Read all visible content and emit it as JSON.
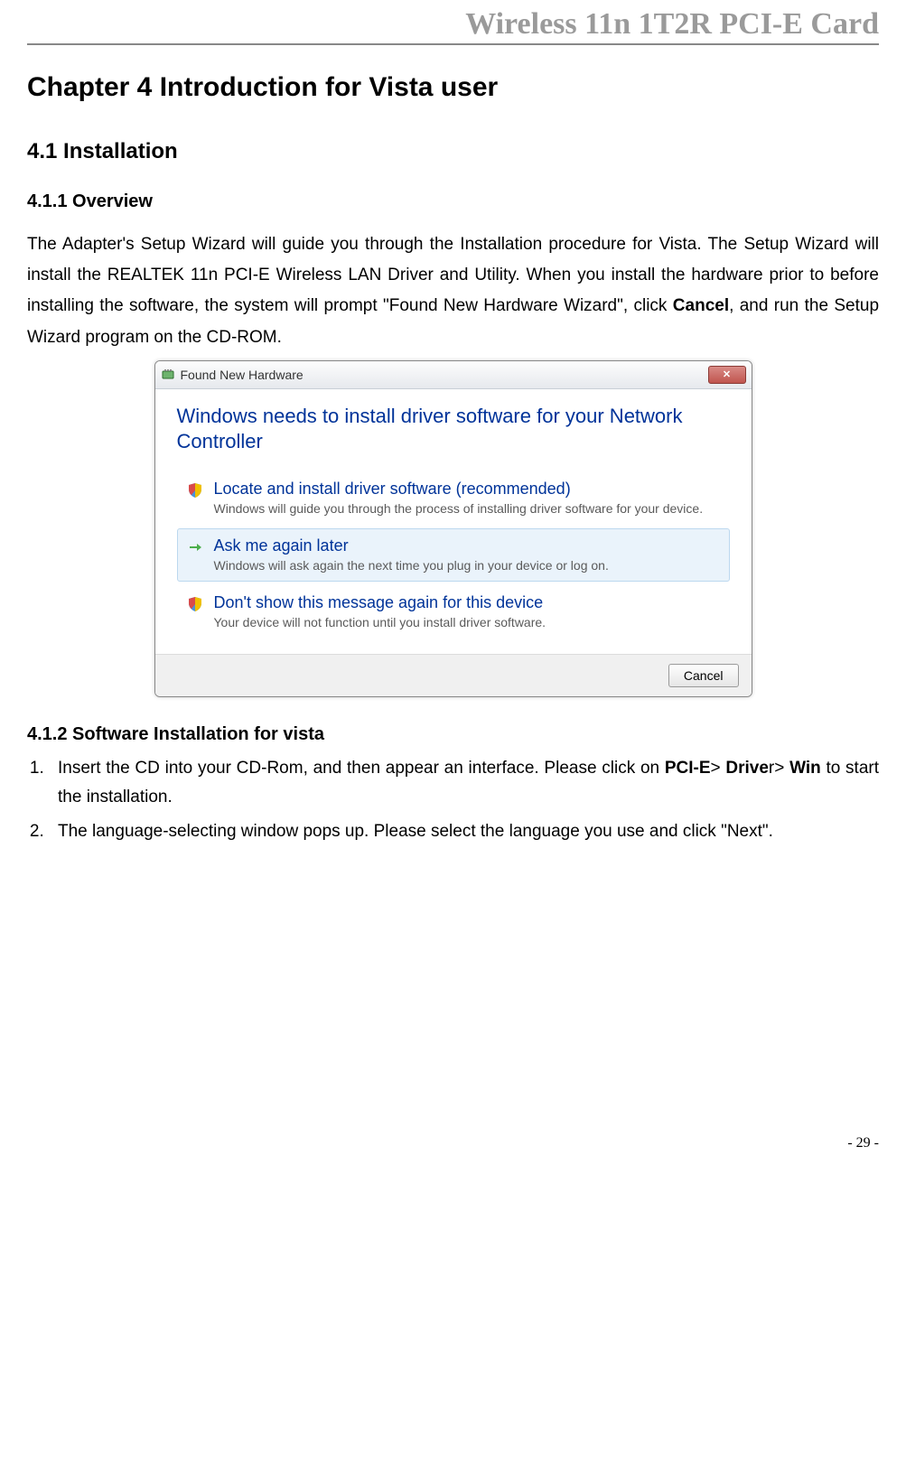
{
  "header": "Wireless 11n 1T2R PCI-E Card",
  "chapter": "Chapter 4    Introduction for Vista user",
  "section_4_1": "4.1 Installation",
  "sub_4_1_1": {
    "title": "4.1.1    Overview",
    "p_part1": "The Adapter's Setup Wizard will guide you through the Installation procedure for Vista. The Setup Wizard will install the REALTEK 11n PCI-E Wireless LAN Driver and Utility. When you install the hardware prior to before installing the software, the system will prompt \"Found New Hardware Wizard\", click ",
    "p_bold": "Cancel",
    "p_part2": ", and run the Setup Wizard program on the CD-ROM."
  },
  "dialog": {
    "title": "Found New Hardware",
    "heading": "Windows needs to install driver software for your Network Controller",
    "opt1": {
      "title": "Locate and install driver software (recommended)",
      "desc": "Windows will guide you through the process of installing driver software for your device."
    },
    "opt2": {
      "title": "Ask me again later",
      "desc": "Windows will ask again the next time you plug in your device or log on."
    },
    "opt3": {
      "title": "Don't show this message again for this device",
      "desc": "Your device will not function until you install driver software."
    },
    "cancel": "Cancel"
  },
  "sub_4_1_2": {
    "title": "4.1.2    Software Installation for vista",
    "li1_a": "Insert the CD into your CD-Rom, and then appear an interface. Please click on ",
    "li1_b1": "PCI-E",
    "li1_gt1": "> ",
    "li1_b2": "Drive",
    "li1_r": "r> ",
    "li1_b3": "Win",
    "li1_c": " to start the installation.",
    "li2": "The language-selecting window pops up. Please select the language you use and click \"Next\"."
  },
  "page_number": "- 29 -"
}
